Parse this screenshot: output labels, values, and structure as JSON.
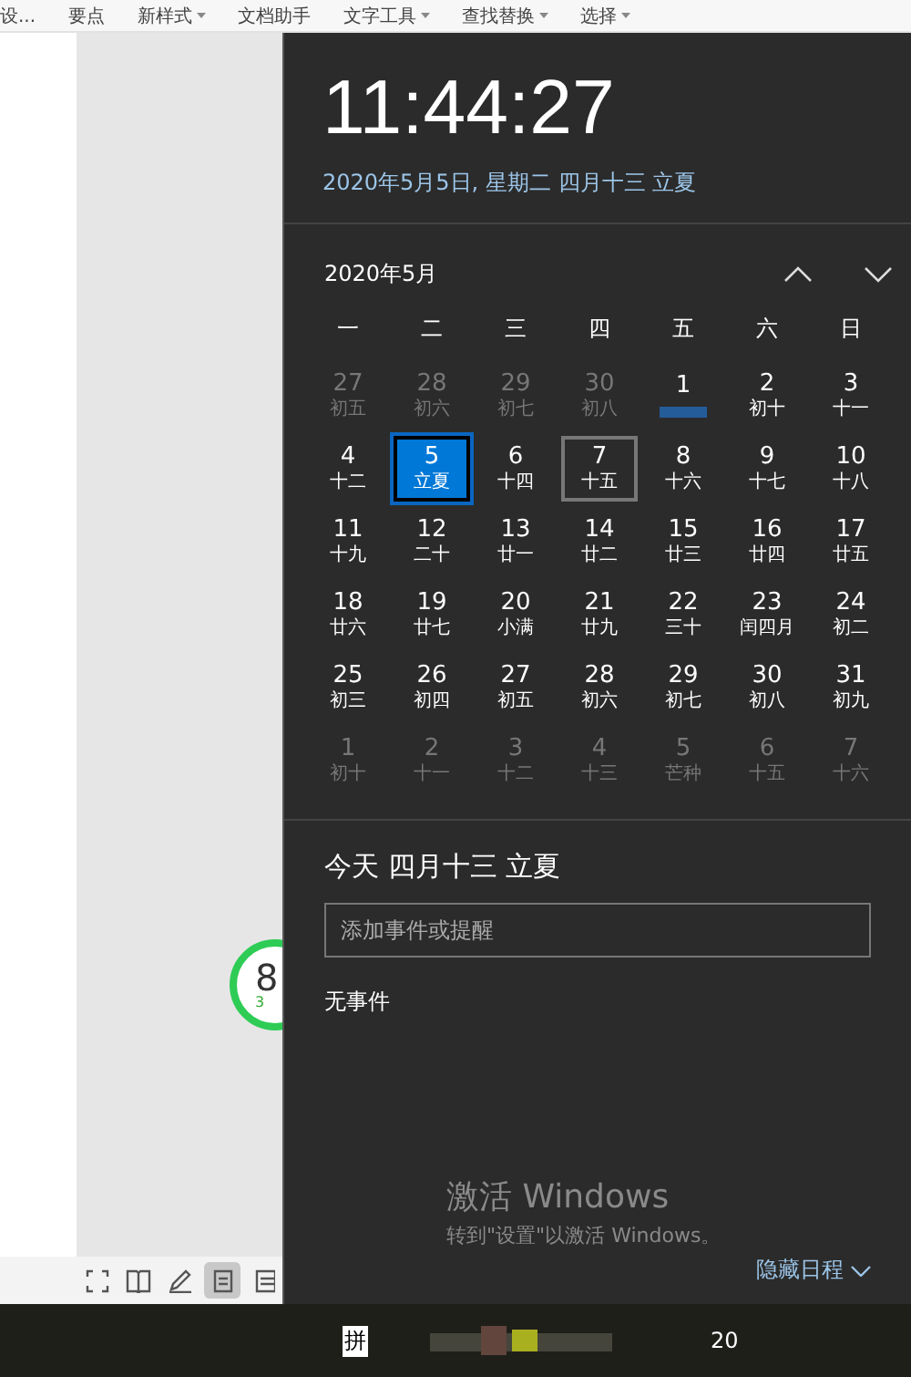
{
  "toolbar": {
    "items": [
      {
        "label": "设...",
        "dropdown": false
      },
      {
        "label": "要点",
        "dropdown": false
      },
      {
        "label": "新样式",
        "dropdown": true
      },
      {
        "label": "文档助手",
        "dropdown": false
      },
      {
        "label": "文字工具",
        "dropdown": true
      },
      {
        "label": "查找替换",
        "dropdown": true
      },
      {
        "label": "选择",
        "dropdown": true
      }
    ]
  },
  "widget": {
    "value": "8",
    "sub": "3"
  },
  "status_bar": {
    "view_buttons": [
      {
        "kind": "fullscreen",
        "selected": false
      },
      {
        "kind": "book",
        "selected": false
      },
      {
        "kind": "pen",
        "selected": false
      },
      {
        "kind": "page",
        "selected": true
      },
      {
        "kind": "outline",
        "selected": false
      }
    ]
  },
  "clock": {
    "time": "11:44:27",
    "date": "2020年5月5日, 星期二 四月十三 立夏"
  },
  "calendar": {
    "month": "2020年5月",
    "weekdays": [
      "一",
      "二",
      "三",
      "四",
      "五",
      "六",
      "日"
    ],
    "weeks": [
      [
        {
          "day": "27",
          "lunar": "初五",
          "in_month": false,
          "selected": false,
          "highlighted": false
        },
        {
          "day": "28",
          "lunar": "初六",
          "in_month": false,
          "selected": false,
          "highlighted": false
        },
        {
          "day": "29",
          "lunar": "初七",
          "in_month": false,
          "selected": false,
          "highlighted": false
        },
        {
          "day": "30",
          "lunar": "初八",
          "in_month": false,
          "selected": false,
          "highlighted": false
        },
        {
          "day": "1",
          "in_month": true,
          "selected": false,
          "highlighted": false
        },
        {
          "day": "2",
          "lunar": "初十",
          "in_month": true,
          "selected": false,
          "highlighted": false
        },
        {
          "day": "3",
          "lunar": "十一",
          "in_month": true,
          "selected": false,
          "highlighted": false
        }
      ],
      [
        {
          "day": "4",
          "lunar": "十二",
          "in_month": true,
          "selected": false,
          "highlighted": false
        },
        {
          "day": "5",
          "lunar": "立夏",
          "in_month": true,
          "selected": true,
          "highlighted": false
        },
        {
          "day": "6",
          "lunar": "十四",
          "in_month": true,
          "selected": false,
          "highlighted": false
        },
        {
          "day": "7",
          "lunar": "十五",
          "in_month": true,
          "selected": false,
          "highlighted": true
        },
        {
          "day": "8",
          "lunar": "十六",
          "in_month": true,
          "selected": false,
          "highlighted": false
        },
        {
          "day": "9",
          "lunar": "十七",
          "in_month": true,
          "selected": false,
          "highlighted": false
        },
        {
          "day": "10",
          "lunar": "十八",
          "in_month": true,
          "selected": false,
          "highlighted": false
        }
      ],
      [
        {
          "day": "11",
          "lunar": "十九",
          "in_month": true,
          "selected": false,
          "highlighted": false
        },
        {
          "day": "12",
          "lunar": "二十",
          "in_month": true,
          "selected": false,
          "highlighted": false
        },
        {
          "day": "13",
          "lunar": "廿一",
          "in_month": true,
          "selected": false,
          "highlighted": false
        },
        {
          "day": "14",
          "lunar": "廿二",
          "in_month": true,
          "selected": false,
          "highlighted": false
        },
        {
          "day": "15",
          "lunar": "廿三",
          "in_month": true,
          "selected": false,
          "highlighted": false
        },
        {
          "day": "16",
          "lunar": "廿四",
          "in_month": true,
          "selected": false,
          "highlighted": false
        },
        {
          "day": "17",
          "lunar": "廿五",
          "in_month": true,
          "selected": false,
          "highlighted": false
        }
      ],
      [
        {
          "day": "18",
          "lunar": "廿六",
          "in_month": true,
          "selected": false,
          "highlighted": false
        },
        {
          "day": "19",
          "lunar": "廿七",
          "in_month": true,
          "selected": false,
          "highlighted": false
        },
        {
          "day": "20",
          "lunar": "小满",
          "in_month": true,
          "selected": false,
          "highlighted": false
        },
        {
          "day": "21",
          "lunar": "廿九",
          "in_month": true,
          "selected": false,
          "highlighted": false
        },
        {
          "day": "22",
          "lunar": "三十",
          "in_month": true,
          "selected": false,
          "highlighted": false
        },
        {
          "day": "23",
          "lunar": "闰四月",
          "in_month": true,
          "selected": false,
          "highlighted": false
        },
        {
          "day": "24",
          "lunar": "初二",
          "in_month": true,
          "selected": false,
          "highlighted": false
        }
      ],
      [
        {
          "day": "25",
          "lunar": "初三",
          "in_month": true,
          "selected": false,
          "highlighted": false
        },
        {
          "day": "26",
          "lunar": "初四",
          "in_month": true,
          "selected": false,
          "highlighted": false
        },
        {
          "day": "27",
          "lunar": "初五",
          "in_month": true,
          "selected": false,
          "highlighted": false
        },
        {
          "day": "28",
          "lunar": "初六",
          "in_month": true,
          "selected": false,
          "highlighted": false
        },
        {
          "day": "29",
          "lunar": "初七",
          "in_month": true,
          "selected": false,
          "highlighted": false
        },
        {
          "day": "30",
          "lunar": "初八",
          "in_month": true,
          "selected": false,
          "highlighted": false
        },
        {
          "day": "31",
          "lunar": "初九",
          "in_month": true,
          "selected": false,
          "highlighted": false
        }
      ],
      [
        {
          "day": "1",
          "lunar": "初十",
          "in_month": false,
          "selected": false,
          "highlighted": false
        },
        {
          "day": "2",
          "lunar": "十一",
          "in_month": false,
          "selected": false,
          "highlighted": false
        },
        {
          "day": "3",
          "lunar": "十二",
          "in_month": false,
          "selected": false,
          "highlighted": false
        },
        {
          "day": "4",
          "lunar": "十三",
          "in_month": false,
          "selected": false,
          "highlighted": false
        },
        {
          "day": "5",
          "lunar": "芒种",
          "in_month": false,
          "selected": false,
          "highlighted": false
        },
        {
          "day": "6",
          "lunar": "十五",
          "in_month": false,
          "selected": false,
          "highlighted": false
        },
        {
          "day": "7",
          "lunar": "十六",
          "in_month": false,
          "selected": false,
          "highlighted": false
        }
      ]
    ]
  },
  "agenda": {
    "heading": "今天 四月十三 立夏",
    "placeholder": "添加事件或提醒",
    "empty_text": "无事件"
  },
  "activation": {
    "title": "激活 Windows",
    "subtitle": "转到\"设置\"以激活 Windows。"
  },
  "hide_agenda": "隐藏日程",
  "taskbar": {
    "ime": "拼",
    "clock": "20"
  }
}
